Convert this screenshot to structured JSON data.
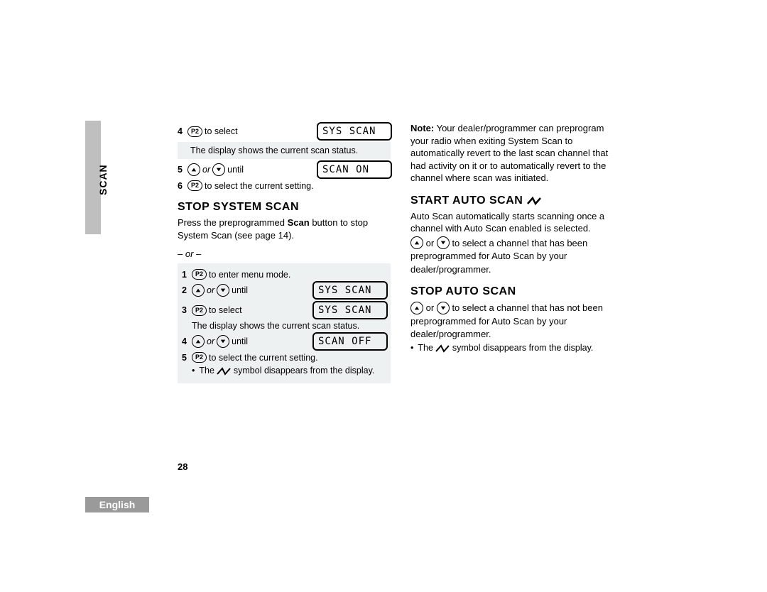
{
  "side_tab": "SCAN",
  "page_number": "28",
  "language": "English",
  "left": {
    "steps_top": [
      {
        "num": "4",
        "p2": "P2",
        "text": "to select",
        "lcd": "SYS  SCAN"
      },
      {
        "status": "The display shows the current scan status."
      },
      {
        "num": "5",
        "or_word": "or",
        "until": "until",
        "lcd": "SCAN  ON"
      },
      {
        "num": "6",
        "p2": "P2",
        "text": "to select the current setting."
      }
    ],
    "heading1": "STOP SYSTEM SCAN",
    "press_line_a": "Press the preprogrammed ",
    "press_bold": "Scan",
    "press_line_b": " button to stop System Scan (see page 14).",
    "or_sep": "– or –",
    "steps_bottom": [
      {
        "num": "1",
        "p2": "P2",
        "text": "to enter menu mode."
      },
      {
        "num": "2",
        "or_word": "or",
        "until": "until",
        "lcd": "SYS  SCAN"
      },
      {
        "num": "3",
        "p2": "P2",
        "text": "to select",
        "lcd": "SYS  SCAN"
      },
      {
        "status": "The display shows the current scan status."
      },
      {
        "num": "4",
        "or_word": "or",
        "until": "until",
        "lcd": "SCAN  OFF"
      },
      {
        "num": "5",
        "p2": "P2",
        "text": "to select the current setting."
      }
    ],
    "bullet_after": "The ",
    "bullet_after2": " symbol disappears from the display."
  },
  "right": {
    "note_label": "Note:",
    "note_text": " Your dealer/programmer can preprogram your radio when exiting System Scan to automatically revert to the last scan channel that had activity on it or to automatically revert to the channel where scan was initiated.",
    "heading_start": "START AUTO SCAN",
    "start_text": "Auto Scan automatically starts scanning once a channel with Auto Scan enabled is selected.",
    "select_or": "or",
    "select_text": " to select a channel that has been preprogrammed for Auto Scan by your dealer/programmer.",
    "heading_stop": "STOP AUTO SCAN",
    "stop_or": "or",
    "stop_text": " to select a channel that has not been preprogrammed for Auto Scan by your dealer/programmer.",
    "bullet_a": "The ",
    "bullet_b": " symbol disappears from the display."
  }
}
